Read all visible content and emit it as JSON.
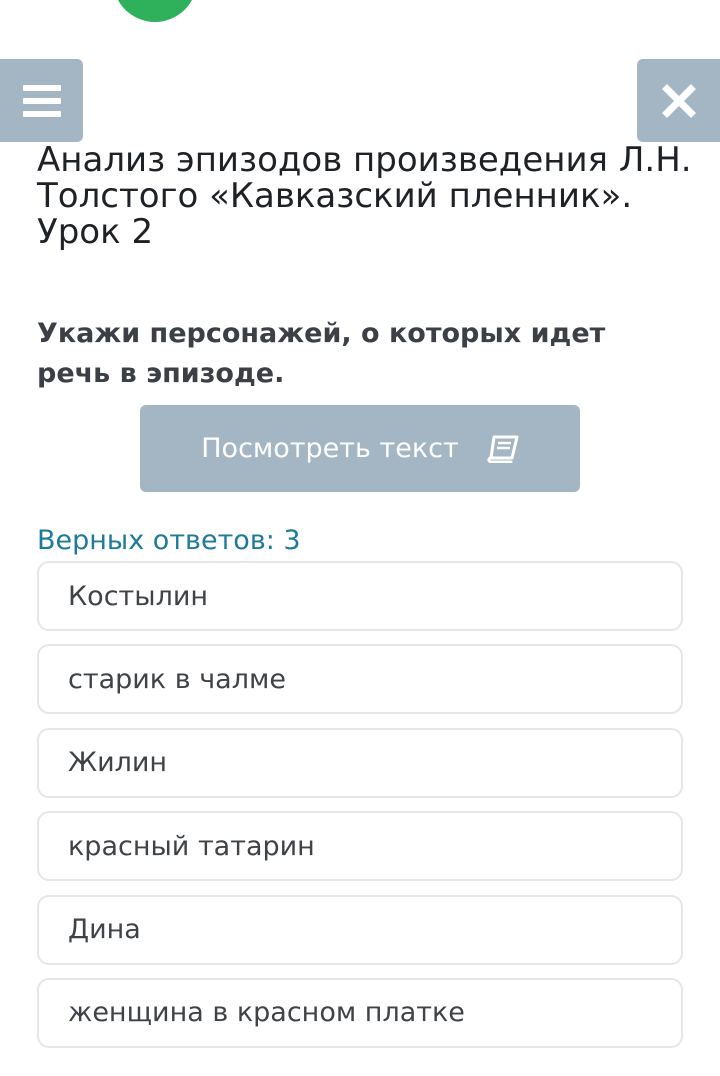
{
  "header": {
    "menu_icon": "hamburger-menu-icon",
    "close_icon": "close-x-icon",
    "top_circle_color": "#2eb15a",
    "button_color": "#a4b6c4"
  },
  "lesson": {
    "title": "Анализ эпизодов произведения Л.Н. Толстого «Кавказский пленник». Урок 2"
  },
  "task": {
    "question": "Укажи персонажей, о которых идет речь в эпизоде.",
    "view_text_button": "Посмотреть текст",
    "view_text_icon": "book-icon",
    "correct_answers": "Верных ответов: 3"
  },
  "options": [
    "Костылин",
    "старик в чалме",
    "Жилин",
    "красный татарин",
    "Дина",
    "женщина в красном платке"
  ]
}
